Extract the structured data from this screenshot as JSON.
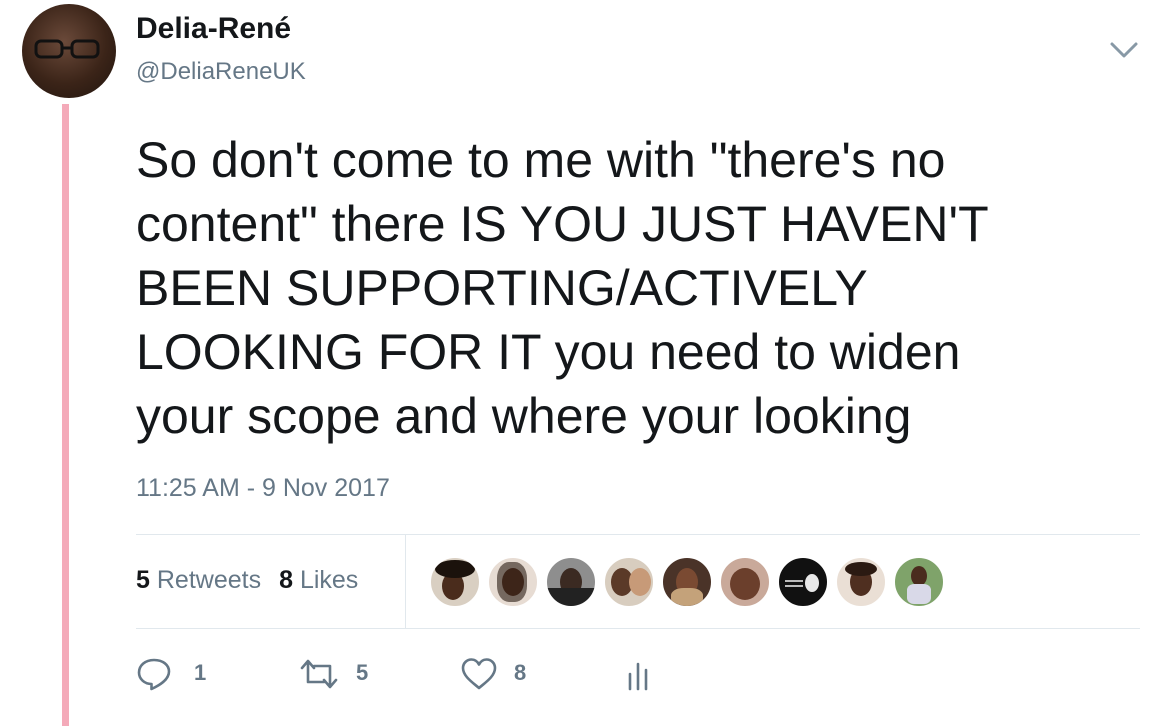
{
  "tweet": {
    "author_name": "Delia-René",
    "author_handle": "@DeliaReneUK",
    "text": "So don't come to me with \"there's no\ncontent\" there IS YOU JUST HAVEN'T\nBEEN SUPPORTING/ACTIVELY\nLOOKING FOR IT you need to widen\nyour scope and where your looking",
    "timestamp": "11:25 AM - 9 Nov 2017"
  },
  "stats": {
    "retweets_count": "5",
    "retweets_label": "Retweets",
    "likes_count": "8",
    "likes_label": "Likes"
  },
  "actions": {
    "reply_count": "1",
    "retweet_count": "5",
    "like_count": "8"
  },
  "icons": {
    "menu": "chevron-down-icon",
    "reply": "reply-icon",
    "retweet": "retweet-icon",
    "like": "heart-icon",
    "analytics": "analytics-icon"
  },
  "colors": {
    "thread_line": "#f4aab9",
    "secondary_text": "#657786",
    "primary_text": "#14171a",
    "divider": "#e1e8ed"
  }
}
